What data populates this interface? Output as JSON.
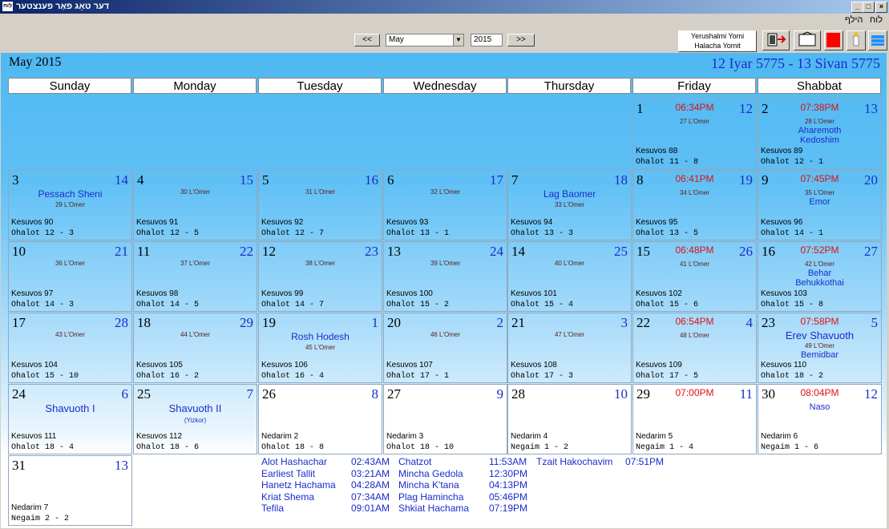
{
  "window": {
    "title": "דער טאָג פאַר פענצטער",
    "icon_text": "לוח"
  },
  "menu": {
    "items": [
      "לוח",
      "הילף"
    ]
  },
  "toolbar": {
    "prev_label": "<<",
    "next_label": ">>",
    "month_value": "May",
    "year_value": "2015",
    "yerushalmi_label": "Yerushalmi Yomi",
    "halacha_label": "Halacha Yomit",
    "icons": [
      "exit-icon",
      "print-icon",
      "red-square-icon",
      "candle-icon",
      "stack-icon"
    ]
  },
  "calendar": {
    "month_title": "May 2015",
    "hebrew_range": "12 Iyar 5775 - 13 Sivan 5775",
    "days": [
      "Sunday",
      "Monday",
      "Tuesday",
      "Wednesday",
      "Thursday",
      "Friday",
      "Shabbat"
    ],
    "colors": {
      "hebrew": "#1a2ccc",
      "candle_time": "#e01010"
    },
    "cells": [
      {
        "row": 0,
        "col": 5,
        "day": "1",
        "heb": "12",
        "time": "06:34PM",
        "omer": "27 L'Omer",
        "text1": "Kesuvos 88",
        "text2": "Ohalot 11 - 8"
      },
      {
        "row": 0,
        "col": 6,
        "day": "2",
        "heb": "13",
        "time": "07:38PM",
        "omer": "28 L'Omer",
        "parsha": [
          "Aharemoth",
          "Kedoshim"
        ],
        "text1": "Kesuvos 89",
        "text2": "Ohalot 12 - 1"
      },
      {
        "row": 1,
        "col": 0,
        "day": "3",
        "heb": "14",
        "holiday": "Pessach Sheni",
        "omer": "29 L'Omer",
        "text1": "Kesuvos 90",
        "text2": "Ohalot 12 - 3"
      },
      {
        "row": 1,
        "col": 1,
        "day": "4",
        "heb": "15",
        "omer": "30 L'Omer",
        "text1": "Kesuvos 91",
        "text2": "Ohalot 12 - 5"
      },
      {
        "row": 1,
        "col": 2,
        "day": "5",
        "heb": "16",
        "omer": "31 L'Omer",
        "text1": "Kesuvos 92",
        "text2": "Ohalot 12 - 7"
      },
      {
        "row": 1,
        "col": 3,
        "day": "6",
        "heb": "17",
        "omer": "32 L'Omer",
        "text1": "Kesuvos 93",
        "text2": "Ohalot 13 - 1"
      },
      {
        "row": 1,
        "col": 4,
        "day": "7",
        "heb": "18",
        "holiday": "Lag Baomer",
        "omer": "33 L'Omer",
        "text1": "Kesuvos 94",
        "text2": "Ohalot 13 - 3"
      },
      {
        "row": 1,
        "col": 5,
        "day": "8",
        "heb": "19",
        "time": "06:41PM",
        "omer": "34 L'Omer",
        "text1": "Kesuvos 95",
        "text2": "Ohalot 13 - 5"
      },
      {
        "row": 1,
        "col": 6,
        "day": "9",
        "heb": "20",
        "time": "07:45PM",
        "omer": "35 L'Omer",
        "parsha": [
          "Emor"
        ],
        "text1": "Kesuvos 96",
        "text2": "Ohalot 14 - 1"
      },
      {
        "row": 2,
        "col": 0,
        "day": "10",
        "heb": "21",
        "omer": "36 L'Omer",
        "text1": "Kesuvos 97",
        "text2": "Ohalot 14 - 3"
      },
      {
        "row": 2,
        "col": 1,
        "day": "11",
        "heb": "22",
        "omer": "37 L'Omer",
        "text1": "Kesuvos 98",
        "text2": "Ohalot 14 - 5"
      },
      {
        "row": 2,
        "col": 2,
        "day": "12",
        "heb": "23",
        "omer": "38 L'Omer",
        "text1": "Kesuvos 99",
        "text2": "Ohalot 14 - 7"
      },
      {
        "row": 2,
        "col": 3,
        "day": "13",
        "heb": "24",
        "omer": "39 L'Omer",
        "text1": "Kesuvos 100",
        "text2": "Ohalot 15 - 2"
      },
      {
        "row": 2,
        "col": 4,
        "day": "14",
        "heb": "25",
        "omer": "40 L'Omer",
        "text1": "Kesuvos 101",
        "text2": "Ohalot 15 - 4"
      },
      {
        "row": 2,
        "col": 5,
        "day": "15",
        "heb": "26",
        "time": "06:48PM",
        "omer": "41 L'Omer",
        "text1": "Kesuvos 102",
        "text2": "Ohalot 15 - 6"
      },
      {
        "row": 2,
        "col": 6,
        "day": "16",
        "heb": "27",
        "time": "07:52PM",
        "omer": "42 L'Omer",
        "parsha": [
          "Behar",
          "Behukkothai"
        ],
        "text1": "Kesuvos 103",
        "text2": "Ohalot 15 - 8"
      },
      {
        "row": 3,
        "col": 0,
        "day": "17",
        "heb": "28",
        "omer": "43 L'Omer",
        "text1": "Kesuvos 104",
        "text2": "Ohalot 15 - 10"
      },
      {
        "row": 3,
        "col": 1,
        "day": "18",
        "heb": "29",
        "omer": "44 L'Omer",
        "text1": "Kesuvos 105",
        "text2": "Ohalot 16 - 2"
      },
      {
        "row": 3,
        "col": 2,
        "day": "19",
        "heb": "1",
        "holiday": "Rosh Hodesh",
        "omer": "45 L'Omer",
        "text1": "Kesuvos 106",
        "text2": "Ohalot 16 - 4"
      },
      {
        "row": 3,
        "col": 3,
        "day": "20",
        "heb": "2",
        "omer": "46 L'Omer",
        "text1": "Kesuvos 107",
        "text2": "Ohalot 17 - 1"
      },
      {
        "row": 3,
        "col": 4,
        "day": "21",
        "heb": "3",
        "omer": "47 L'Omer",
        "text1": "Kesuvos 108",
        "text2": "Ohalot 17 - 3"
      },
      {
        "row": 3,
        "col": 5,
        "day": "22",
        "heb": "4",
        "time": "06:54PM",
        "omer": "48 L'Omer",
        "text1": "Kesuvos 109",
        "text2": "Ohalot 17 - 5"
      },
      {
        "row": 3,
        "col": 6,
        "day": "23",
        "heb": "5",
        "time": "07:58PM",
        "holiday": "Erev Shavuoth",
        "omer": "49 L'Omer",
        "parsha": [
          "Bemidbar"
        ],
        "text1": "Kesuvos 110",
        "text2": "Ohalot 18 - 2"
      },
      {
        "row": 4,
        "col": 0,
        "day": "24",
        "heb": "6",
        "holiday": "Shavuoth I",
        "text1": "Kesuvos 111",
        "text2": "Ohalot 18 - 4"
      },
      {
        "row": 4,
        "col": 1,
        "day": "25",
        "heb": "7",
        "holiday": "Shavuoth II",
        "sub": "(Yizkor)",
        "text1": "Kesuvos 112",
        "text2": "Ohalot 18 - 6"
      },
      {
        "row": 4,
        "col": 2,
        "day": "26",
        "heb": "8",
        "text1": "Nedarim 2",
        "text2": "Ohalot 18 - 8",
        "white": true
      },
      {
        "row": 4,
        "col": 3,
        "day": "27",
        "heb": "9",
        "text1": "Nedarim 3",
        "text2": "Ohalot 18 - 10",
        "white": true
      },
      {
        "row": 4,
        "col": 4,
        "day": "28",
        "heb": "10",
        "text1": "Nedarim 4",
        "text2": "Negaim 1 - 2",
        "white": true
      },
      {
        "row": 4,
        "col": 5,
        "day": "29",
        "heb": "11",
        "time": "07:00PM",
        "text1": "Nedarim 5",
        "text2": "Negaim 1 - 4",
        "white": true
      },
      {
        "row": 4,
        "col": 6,
        "day": "30",
        "heb": "12",
        "time": "08:04PM",
        "parsha": [
          "Naso"
        ],
        "text1": "Nedarim 6",
        "text2": "Negaim 1 - 6",
        "white": true
      },
      {
        "row": 5,
        "col": 0,
        "day": "31",
        "heb": "13",
        "text1": "Nedarim 7",
        "text2": "Negaim 2 - 2",
        "white": true
      }
    ]
  },
  "zmanim": [
    [
      "Alot Hashachar",
      "02:43AM"
    ],
    [
      "Earliest Tallit",
      "03:21AM"
    ],
    [
      "Hanetz Hachama",
      "04:28AM"
    ],
    [
      "Kriat Shema",
      "07:34AM"
    ],
    [
      "Tefila",
      "09:01AM"
    ],
    [
      "Chatzot",
      "11:53AM"
    ],
    [
      "Mincha Gedola",
      "12:30PM"
    ],
    [
      "Mincha K'tana",
      "04:13PM"
    ],
    [
      "Plag Hamincha",
      "05:46PM"
    ],
    [
      "Shkiat Hachama",
      "07:19PM"
    ],
    [
      "Tzait Hakochavim",
      "07:51PM"
    ]
  ]
}
